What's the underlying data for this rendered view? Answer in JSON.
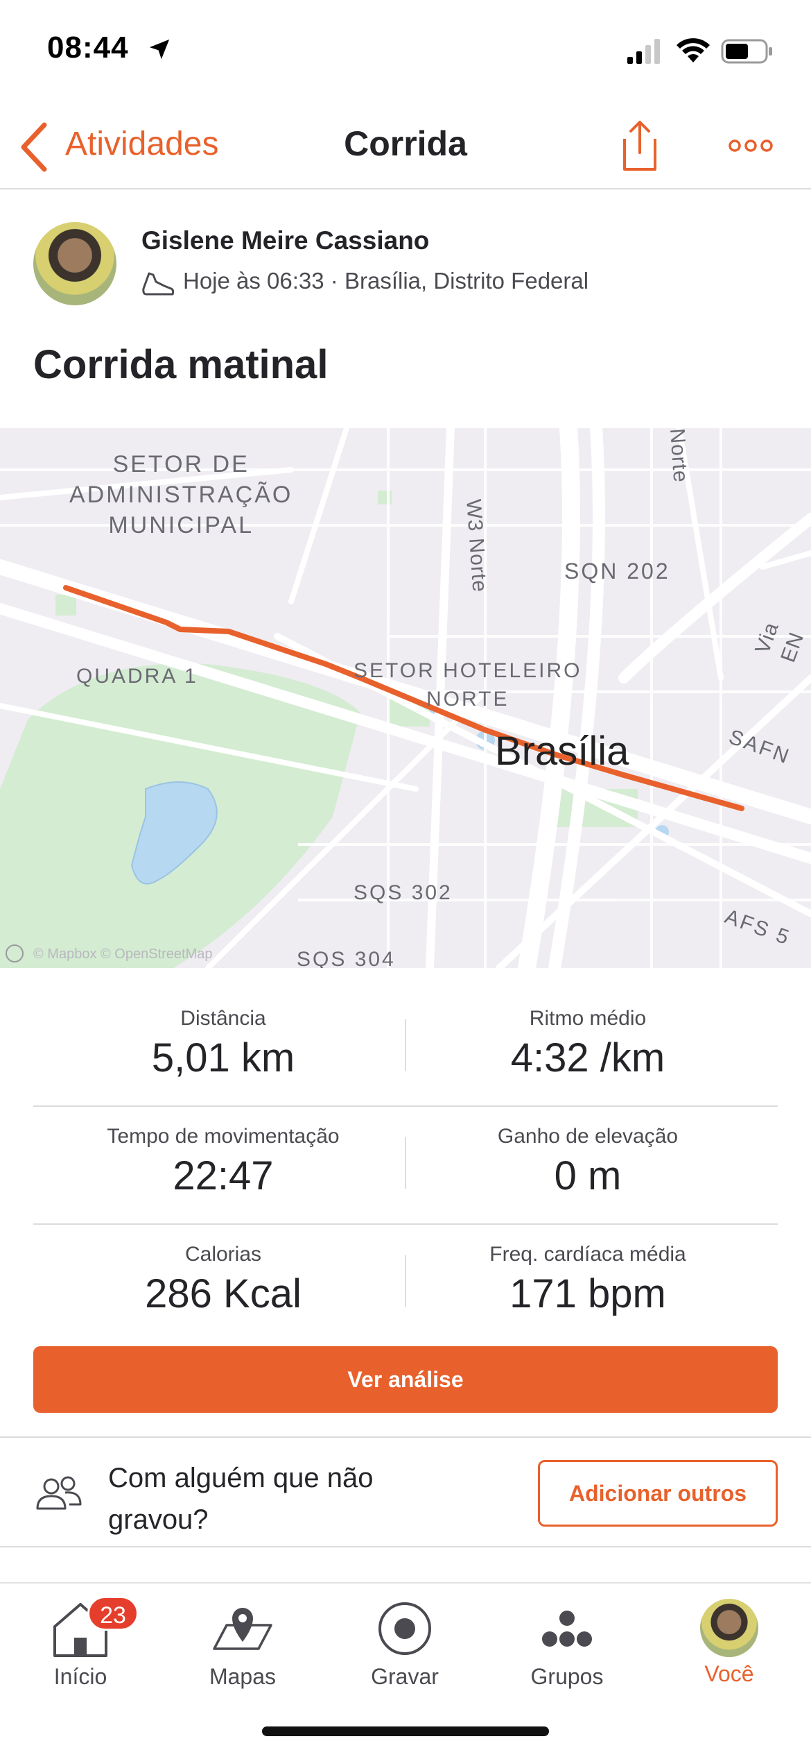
{
  "status_bar": {
    "time": "08:44"
  },
  "nav": {
    "back_label": "Atividades",
    "title": "Corrida"
  },
  "athlete": {
    "name": "Gislene Meire Cassiano",
    "meta": "Hoje às 06:33 · Brasília, Distrito Federal"
  },
  "activity": {
    "title": "Corrida matinal"
  },
  "map": {
    "labels": {
      "setor_admin": "SETOR DE\nADMINISTRAÇÃO\nMUNICIPAL",
      "w3_norte": "W3 Norte",
      "norte": "Norte",
      "sqn_202": "SQN 202",
      "quadra_1": "QUADRA 1",
      "setor_hoteleiro": "SETOR HOTELEIRO\nNORTE",
      "brasilia": "Brasília",
      "safn": "SAFN",
      "via_en": "Via EN",
      "sqs_302": "SQS 302",
      "sqs_304": "SQS 304",
      "afs_5": "AFS 5"
    },
    "attribution": "© Mapbox © OpenStreetMap",
    "route_color": "#e8612c"
  },
  "stats": [
    {
      "left": {
        "label": "Distância",
        "value": "5,01 km"
      },
      "right": {
        "label": "Ritmo médio",
        "value": "4:32 /km"
      }
    },
    {
      "left": {
        "label": "Tempo de movimentação",
        "value": "22:47"
      },
      "right": {
        "label": "Ganho de elevação",
        "value": "0 m"
      }
    },
    {
      "left": {
        "label": "Calorias",
        "value": "286 Kcal"
      },
      "right": {
        "label": "Freq. cardíaca média",
        "value": "171 bpm"
      }
    }
  ],
  "analysis_button": "Ver análise",
  "with_someone": {
    "text": "Com alguém que não gravou?",
    "button": "Adicionar outros"
  },
  "tabs": [
    {
      "label": "Início",
      "icon": "home-icon",
      "badge": "23"
    },
    {
      "label": "Mapas",
      "icon": "map-pin-icon"
    },
    {
      "label": "Gravar",
      "icon": "record-icon"
    },
    {
      "label": "Grupos",
      "icon": "groups-icon"
    },
    {
      "label": "Você",
      "icon": "avatar",
      "active": true
    }
  ],
  "colors": {
    "accent": "#e8612c",
    "badge": "#e53e2c"
  }
}
